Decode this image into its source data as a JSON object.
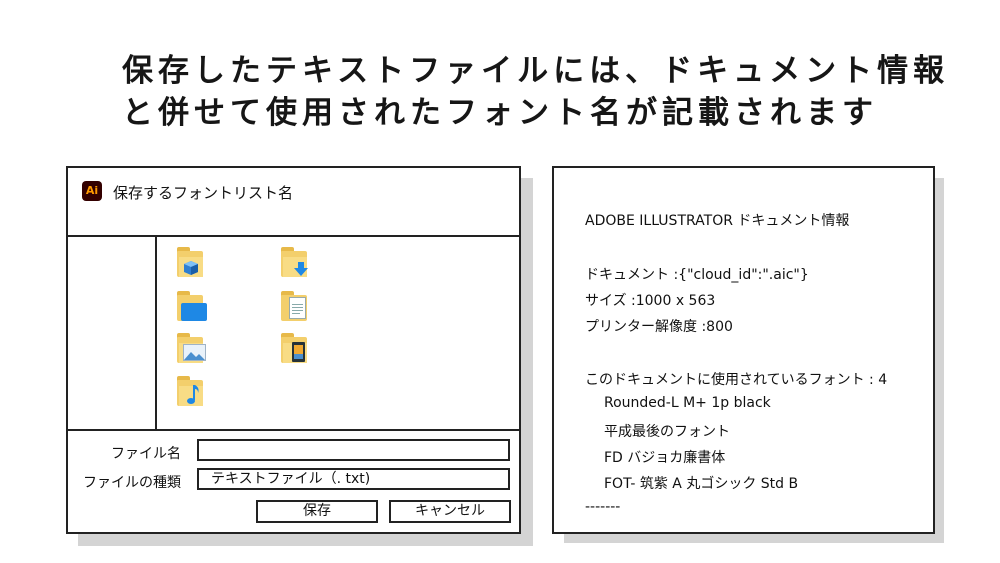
{
  "headline": {
    "line1": "保存したテキストファイルには、ドキュメント情報",
    "line2": "と併せて使用されたフォント名が記載されます"
  },
  "dialog": {
    "app_icon": "Ai",
    "title": "保存するフォントリスト名",
    "folders": [
      {
        "icon": "3d-objects-folder-icon"
      },
      {
        "icon": "downloads-folder-icon"
      },
      {
        "icon": "desktop-folder-icon"
      },
      {
        "icon": "documents-folder-icon"
      },
      {
        "icon": "pictures-folder-icon"
      },
      {
        "icon": "videos-folder-icon"
      },
      {
        "icon": "music-folder-icon"
      }
    ],
    "filename_label": "ファイル名",
    "filename_value": "",
    "filetype_label": "ファイルの種類",
    "filetype_value": "テキストファイル（.  txt)",
    "save_button": "保存",
    "cancel_button": "キャンセル"
  },
  "info": {
    "heading": "ADOBE ILLUSTRATOR ドキュメント情報",
    "document": "ドキュメント :{\"cloud_id\":\".aic\"}",
    "size": "サイズ :1000 x 563",
    "printer_resolution": "プリンター解像度 :800",
    "fonts_heading": "このドキュメントに使用されているフォント : 4",
    "fonts": [
      "Rounded-L M+ 1p black",
      "平成最後のフォント",
      "FD バジョカ廉書体",
      "FOT- 筑紫 A 丸ゴシック Std B"
    ],
    "separator": "-------"
  },
  "colors": {
    "ai_icon_bg": "#330000",
    "ai_icon_text": "#ff9a00",
    "folder_yellow": "#f3cf6c",
    "accent_blue": "#1e88e5"
  }
}
